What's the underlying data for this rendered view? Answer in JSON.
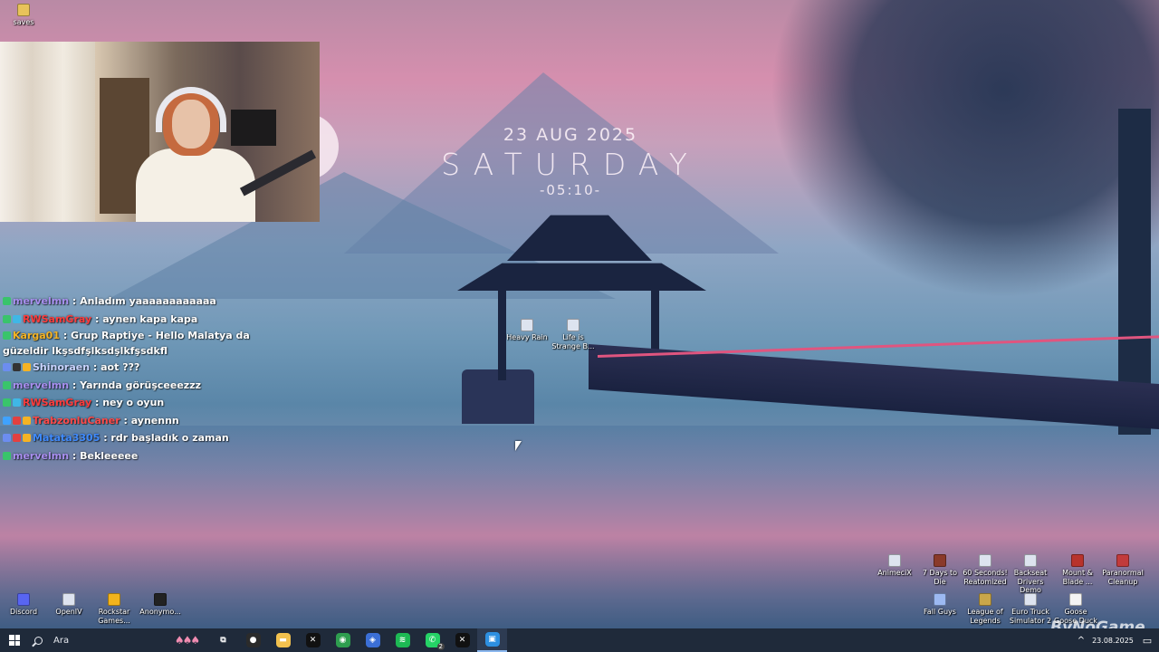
{
  "desktop": {
    "top_left_icon": {
      "label": "saves",
      "icon": "folder-icon"
    },
    "clock_widget": {
      "date": "23 AUG 2025",
      "day": "SATURDAY",
      "time": "-05:10-"
    },
    "center_icons": [
      {
        "label": "Heavy Rain"
      },
      {
        "label": "Life is Strange B..."
      }
    ],
    "bottom_left_icons": [
      {
        "label": "Discord"
      },
      {
        "label": "OpenIV"
      },
      {
        "label": "Rockstar Games..."
      },
      {
        "label": "Anonymo..."
      }
    ],
    "bottom_right_icons_row1": [
      {
        "label": "AnimeciX"
      },
      {
        "label": "7 Days to Die"
      },
      {
        "label": "60 Seconds! Reatomized"
      },
      {
        "label": "Backseat Drivers Demo"
      },
      {
        "label": "Mount & Blade ..."
      },
      {
        "label": "Paranormal Cleanup"
      }
    ],
    "bottom_right_icons_row2": [
      {
        "label": "Fall Guys"
      },
      {
        "label": "League of Legends"
      },
      {
        "label": "Euro Truck Simulator 2"
      },
      {
        "label": "Goose Goose Duck"
      }
    ]
  },
  "chat": {
    "messages": [
      {
        "user": "mervelmn",
        "color": "#a98ff0",
        "text": ": Anladım yaaaaaaaaaaaa",
        "badges": [
          "#39c46b"
        ]
      },
      {
        "user": "RWSamGray",
        "color": "#ff3c3c",
        "text": ": aynen kapa kapa",
        "badges": [
          "#39c46b",
          "#3fb7e6"
        ]
      },
      {
        "user": "Karga01",
        "color": "#f5b324",
        "text": ": Grup Raptiye - Hello Malatya da güzeldir lkşsdfşlksdşlkfşsdkfl",
        "badges": [
          "#39c46b"
        ]
      },
      {
        "user": "Shinoraen",
        "color": "#c9d4ff",
        "text": ": aot ???",
        "badges": [
          "#6c8df0",
          "#333333",
          "#f5b324"
        ]
      },
      {
        "user": "mervelmn",
        "color": "#a98ff0",
        "text": ": Yarında görüşceeezzz",
        "badges": [
          "#39c46b"
        ]
      },
      {
        "user": "RWSamGray",
        "color": "#ff3c3c",
        "text": ": ney o oyun",
        "badges": [
          "#39c46b",
          "#3fb7e6"
        ]
      },
      {
        "user": "TrabzonluCaner",
        "color": "#ff4a4a",
        "text": ": aynennn",
        "badges": [
          "#3fa2ff",
          "#e34040",
          "#f5b324"
        ]
      },
      {
        "user": "Matata3305",
        "color": "#3f8bff",
        "text": ": rdr başladık o zaman",
        "badges": [
          "#6c8df0",
          "#e34040",
          "#f5b324"
        ]
      },
      {
        "user": "mervelmn",
        "color": "#a98ff0",
        "text": ": Bekleeeee",
        "badges": [
          "#39c46b"
        ]
      }
    ]
  },
  "taskbar": {
    "search_placeholder": "Ara",
    "apps": [
      {
        "name": "task-view-icon",
        "glyph": "⧉",
        "bg": "transparent"
      },
      {
        "name": "obs-icon",
        "glyph": "●",
        "bg": "#2b2b2b"
      },
      {
        "name": "file-explorer-icon",
        "glyph": "▬",
        "bg": "#f2c14e"
      },
      {
        "name": "capcut-icon",
        "glyph": "✕",
        "bg": "#111111"
      },
      {
        "name": "chrome-icon",
        "glyph": "◉",
        "bg": "#2e9e4f"
      },
      {
        "name": "cursor-app-icon",
        "glyph": "◈",
        "bg": "#3b6fd6"
      },
      {
        "name": "spotify-icon",
        "glyph": "≋",
        "bg": "#1db954"
      },
      {
        "name": "whatsapp-icon",
        "glyph": "✆",
        "bg": "#25d366",
        "badge": "2"
      },
      {
        "name": "capcut-icon-2",
        "glyph": "✕",
        "bg": "#111111"
      },
      {
        "name": "app-window-icon",
        "glyph": "▣",
        "bg": "#2d8fe0",
        "active": true
      }
    ],
    "tray": {
      "date": "23.08.2025",
      "chevron": "^"
    }
  },
  "watermark": "ByNoGame"
}
